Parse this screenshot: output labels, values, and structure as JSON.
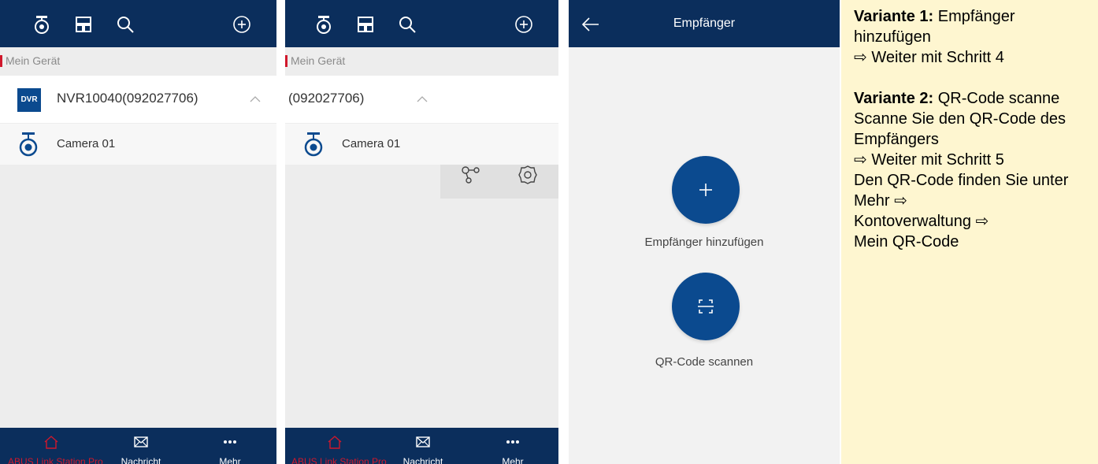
{
  "screen1": {
    "section_label": "Mein Gerät",
    "device_badge": "DVR",
    "device_name": "NVR10040(092027706)",
    "camera_name": "Camera 01",
    "bottom_nav": [
      {
        "label": "ABUS Link Station Pro",
        "active": true
      },
      {
        "label": "Nachricht",
        "active": false
      },
      {
        "label": "Mehr",
        "active": false
      }
    ]
  },
  "screen2": {
    "section_label": "Mein Gerät",
    "device_name": "(092027706)",
    "camera_name": "Camera 01",
    "bottom_nav": [
      {
        "label": "ABUS Link Station Pro",
        "active": true
      },
      {
        "label": "Nachricht",
        "active": false
      },
      {
        "label": "Mehr",
        "active": false
      }
    ]
  },
  "screen3": {
    "title": "Empfänger",
    "add_label": "Empfänger hinzufügen",
    "scan_label": "QR-Code scannen"
  },
  "note": {
    "v1_title": "Variante 1:",
    "v1_text": "Empfänger hinzufügen",
    "v1_next": "⇨ Weiter mit Schritt 4",
    "v2_title": "Variante 2:",
    "v2_text": "QR-Code scanne",
    "v2_line1": "Scanne Sie den QR-Code des Empfängers",
    "v2_next": "⇨ Weiter mit Schritt 5",
    "v2_line2": "Den QR-Code finden Sie unter",
    "v2_path1": "Mehr ⇨",
    "v2_path2": "Kontoverwaltung ⇨",
    "v2_path3": "Mein QR-Code"
  },
  "colors": {
    "navy": "#0b2e5c",
    "brand_blue": "#0b4a8f",
    "accent_red": "#d0182c",
    "note_bg": "#fef6d0"
  }
}
